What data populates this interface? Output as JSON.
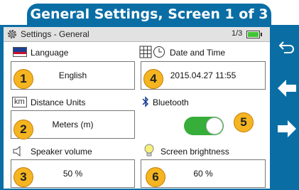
{
  "banner": {
    "title": "General Settings, Screen 1 of 3"
  },
  "titlebar": {
    "title": "Settings - General",
    "page": "1/3"
  },
  "settings": {
    "language": {
      "label": "Language",
      "value": "English",
      "number": "1"
    },
    "distance_units": {
      "label": "Distance Units",
      "icon_text": "km",
      "value": "Meters (m)",
      "number": "2"
    },
    "speaker_volume": {
      "label": "Speaker volume",
      "value": "50",
      "unit": "%",
      "number": "3"
    },
    "date_time": {
      "label": "Date and Time",
      "value": "2015.04.27 11:55",
      "number": "4"
    },
    "bluetooth": {
      "label": "Bluetooth",
      "state": "on",
      "number": "5"
    },
    "screen_brightness": {
      "label": "Screen brightness",
      "value": "60",
      "unit": "%",
      "number": "6"
    }
  },
  "nav": {
    "icons": [
      "back-icon",
      "arrow-left-icon",
      "arrow-right-icon"
    ]
  },
  "colors": {
    "frame": "#0a6ea5",
    "callout": "#f5b521",
    "toggle_on": "#37ad3a",
    "battery": "#41c435"
  }
}
